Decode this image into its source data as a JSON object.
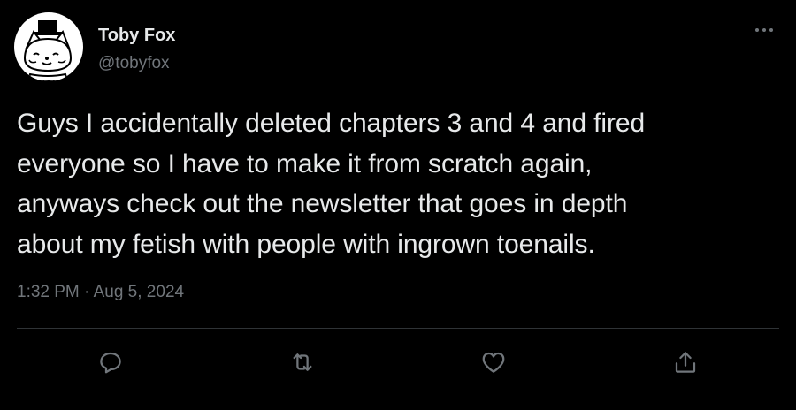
{
  "author": {
    "display_name": "Toby Fox",
    "handle": "@tobyfox"
  },
  "tweet": {
    "text": "Guys I accidentally deleted chapters 3 and 4 and fired\neveryone so I have to make it from scratch again,\nanyways check out the newsletter that goes in depth\nabout my fetish with people with ingrown toenails.",
    "timestamp": "1:32 PM · Aug 5, 2024"
  },
  "actions": [
    {
      "name": "reply",
      "icon": "reply-icon"
    },
    {
      "name": "retweet",
      "icon": "retweet-icon"
    },
    {
      "name": "like",
      "icon": "heart-icon"
    },
    {
      "name": "share",
      "icon": "share-icon"
    }
  ],
  "colors": {
    "background": "#000000",
    "text_primary": "#e7e9ea",
    "text_secondary": "#71767b",
    "divider": "#2f3336"
  }
}
